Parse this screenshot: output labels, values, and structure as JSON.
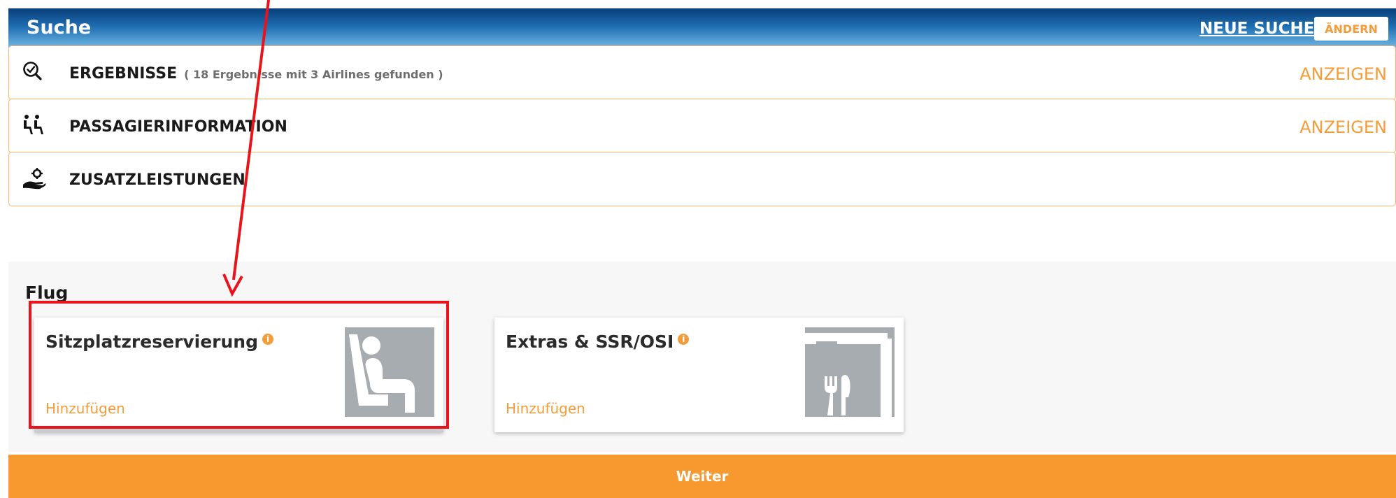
{
  "header": {
    "title": "Suche",
    "new_search": "NEUE SUCHE",
    "change": "ÄNDERN"
  },
  "panels": [
    {
      "label": "ERGEBNISSE",
      "sub": "( 18 Ergebnisse mit 3 Airlines gefunden )",
      "action": "ANZEIGEN",
      "icon": "magnifier-check-icon"
    },
    {
      "label": "PASSAGIERINFORMATION",
      "action": "ANZEIGEN",
      "icon": "passengers-icon"
    },
    {
      "label": "ZUSATZLEISTUNGEN",
      "icon": "hand-gear-icon"
    }
  ],
  "flug": {
    "title": "Flug",
    "cards": [
      {
        "title": "Sitzplatzreservierung",
        "info": "i",
        "add": "Hinzufügen",
        "icon": "seat-icon"
      },
      {
        "title": "Extras & SSR/OSI",
        "info": "i",
        "add": "Hinzufügen",
        "icon": "meal-icon"
      }
    ]
  },
  "footer": {
    "button": "Weiter"
  },
  "colors": {
    "accent": "#f39c3a",
    "header_dark": "#0a3f7a",
    "header_light": "#6fb6e4",
    "highlight": "#e8131b"
  }
}
